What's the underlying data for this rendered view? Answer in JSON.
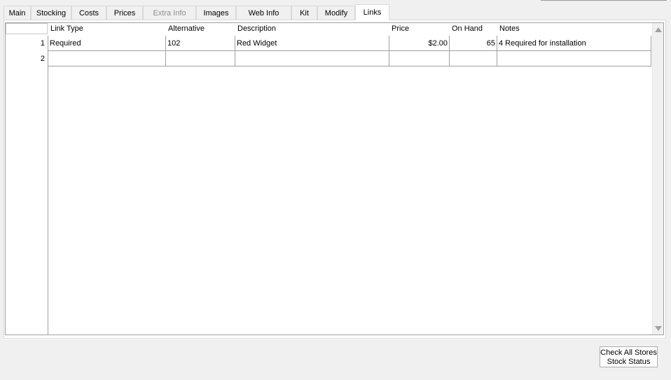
{
  "tabs": [
    {
      "label": "Main",
      "state": "normal"
    },
    {
      "label": "Stocking",
      "state": "normal"
    },
    {
      "label": "Costs",
      "state": "normal"
    },
    {
      "label": "Prices",
      "state": "normal"
    },
    {
      "label": "Extra Info",
      "state": "disabled"
    },
    {
      "label": "Images",
      "state": "normal"
    },
    {
      "label": "Web Info",
      "state": "normal"
    },
    {
      "label": "Kit",
      "state": "normal"
    },
    {
      "label": "Modify",
      "state": "normal"
    },
    {
      "label": "Links",
      "state": "active"
    }
  ],
  "grid": {
    "columns": [
      "Link Type",
      "Alternative",
      "Description",
      "Price",
      "On Hand",
      "Notes"
    ],
    "rows": [
      {
        "num": "1",
        "link_type": "Required",
        "alternative": "102",
        "description": "Red Widget",
        "price": "$2.00",
        "on_hand": "65",
        "notes": "4 Required for installation"
      },
      {
        "num": "2",
        "link_type": "",
        "alternative": "",
        "description": "",
        "price": "",
        "on_hand": "",
        "notes": ""
      }
    ]
  },
  "buttons": {
    "check_stock_line1": "Check All Stores",
    "check_stock_line2": "Stock Status"
  },
  "colors": {
    "panel_bg": "#ffffff",
    "window_bg": "#f0f0f0",
    "grid_line": "#a0a0a0"
  }
}
